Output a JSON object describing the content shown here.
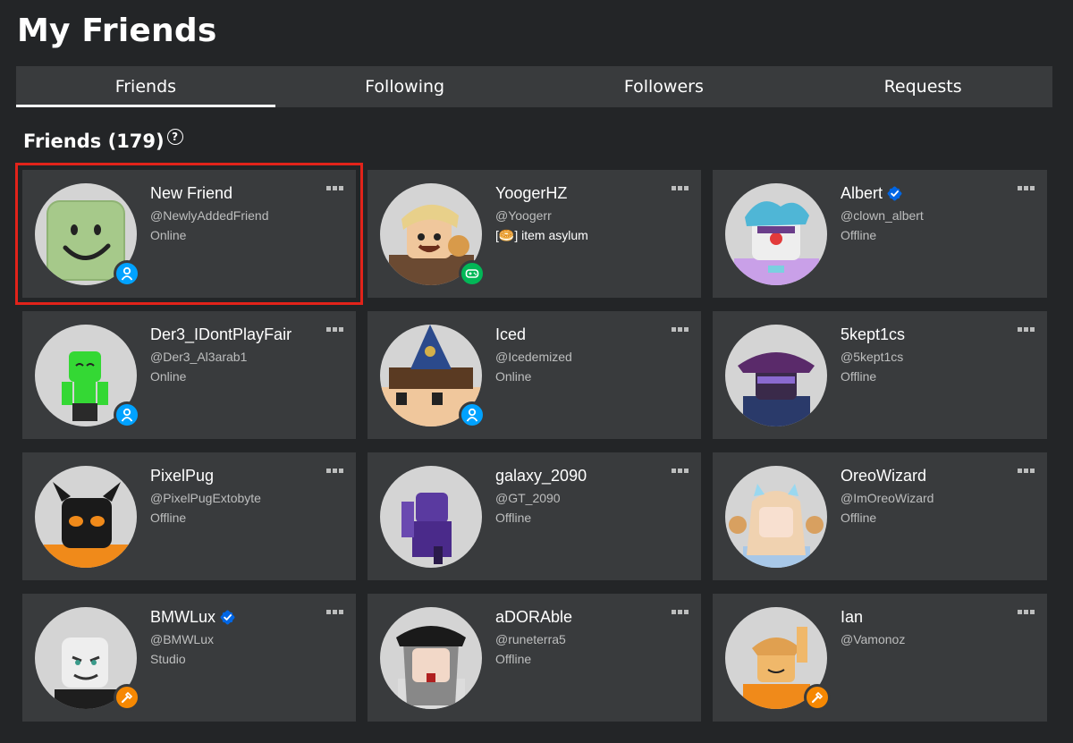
{
  "page": {
    "title": "My Friends"
  },
  "tabs": [
    {
      "label": "Friends",
      "active": true
    },
    {
      "label": "Following",
      "active": false
    },
    {
      "label": "Followers",
      "active": false
    },
    {
      "label": "Requests",
      "active": false
    }
  ],
  "section": {
    "title": "Friends (179)",
    "help_icon": "question-circle-icon"
  },
  "colors": {
    "background": "#232527",
    "card": "#393b3d",
    "highlight": "#e2231a",
    "online": "#00a2ff",
    "in_game": "#02b757",
    "studio": "#f68802",
    "verified": "#0066e4"
  },
  "friends": [
    {
      "name": "New Friend",
      "handle": "@NewlyAddedFriend",
      "status": "Online",
      "presence": "online",
      "verified": false,
      "highlighted": true
    },
    {
      "name": "YoogerHZ",
      "handle": "@Yoogerr",
      "status": "[🥯] item asylum",
      "presence": "game",
      "verified": false,
      "highlighted": false
    },
    {
      "name": "Albert",
      "handle": "@clown_albert",
      "status": "Offline",
      "presence": "offline",
      "verified": true,
      "highlighted": false
    },
    {
      "name": "Der3_IDontPlayFair",
      "handle": "@Der3_Al3arab1",
      "status": "Online",
      "presence": "online",
      "verified": false,
      "highlighted": false
    },
    {
      "name": "Iced",
      "handle": "@Icedemized",
      "status": "Online",
      "presence": "online",
      "verified": false,
      "highlighted": false
    },
    {
      "name": "5kept1cs",
      "handle": "@5kept1cs",
      "status": "Offline",
      "presence": "offline",
      "verified": false,
      "highlighted": false
    },
    {
      "name": "PixelPug",
      "handle": "@PixelPugExtobyte",
      "status": "Offline",
      "presence": "offline",
      "verified": false,
      "highlighted": false
    },
    {
      "name": "galaxy_2090",
      "handle": "@GT_2090",
      "status": "Offline",
      "presence": "offline",
      "verified": false,
      "highlighted": false
    },
    {
      "name": "OreoWizard",
      "handle": "@ImOreoWizard",
      "status": "Offline",
      "presence": "offline",
      "verified": false,
      "highlighted": false
    },
    {
      "name": "BMWLux",
      "handle": "@BMWLux",
      "status": "Studio",
      "presence": "studio",
      "verified": true,
      "highlighted": false
    },
    {
      "name": "aDORAble",
      "handle": "@runeterra5",
      "status": "Offline",
      "presence": "offline",
      "verified": false,
      "highlighted": false
    },
    {
      "name": "Ian",
      "handle": "@Vamonoz",
      "status": "",
      "presence": "studio",
      "verified": false,
      "highlighted": false
    }
  ]
}
